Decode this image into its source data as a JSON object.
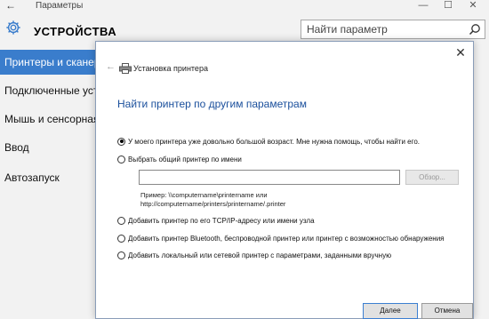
{
  "settings": {
    "window_title": "Параметры",
    "back_glyph": "←",
    "min_glyph": "—",
    "max_glyph": "☐",
    "close_glyph": "✕",
    "header_title": "УСТРОЙСТВА",
    "search_placeholder": "Найти параметр",
    "sidebar": {
      "items": [
        {
          "label": "Принтеры и сканеры",
          "active": true
        },
        {
          "label": "Подключенные устройства",
          "active": false
        },
        {
          "label": "Мышь и сенсорная панель",
          "active": false
        },
        {
          "label": "Ввод",
          "active": false
        },
        {
          "label": "Автозапуск",
          "active": false
        }
      ]
    },
    "accent_color": "#3a7dcc"
  },
  "dialog": {
    "title": "Установка принтера",
    "back_glyph": "←",
    "close_glyph": "✕",
    "heading": "Найти принтер по другим параметрам",
    "heading_color": "#1a4f9c",
    "options": [
      {
        "label": "У моего принтера уже довольно большой возраст. Мне нужна помощь, чтобы найти его.",
        "checked": true
      },
      {
        "label": "Выбрать общий принтер по имени",
        "checked": false
      },
      {
        "label": "Добавить принтер по его TCP/IP-адресу или имени узла",
        "checked": false
      },
      {
        "label": "Добавить принтер Bluetooth, беспроводной принтер или принтер с возможностью обнаружения",
        "checked": false
      },
      {
        "label": "Добавить локальный или сетевой принтер с параметрами, заданными вручную",
        "checked": false
      }
    ],
    "name_input_value": "",
    "browse_label": "Обзор...",
    "example_line1": "Пример: \\\\computername\\printername или",
    "example_line2": "http://computername/printers/printername/.printer",
    "next_label": "Далее",
    "cancel_label": "Отмена"
  }
}
